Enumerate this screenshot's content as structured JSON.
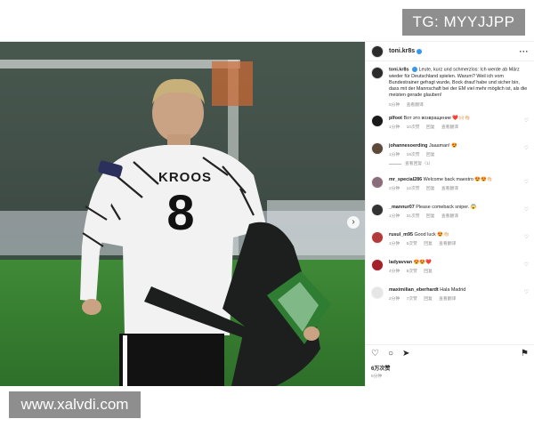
{
  "watermarks": {
    "top": "TG: MYYJJPP",
    "bottom": "www.xalvdi.com"
  },
  "photo": {
    "jersey_name": "KROOS",
    "jersey_number": "8"
  },
  "header": {
    "username": "toni.kr8s",
    "more": "···"
  },
  "caption": {
    "username": "toni.kr8s",
    "text": "Leute, kurz und schmerzlos: Ich werde ab März wieder für Deutschland spielen. Warum? Weil ich vom Bundestrainer gefragt wurde, Bock drauf habe und sicher bin, dass mit der Mannschaft bei der EM viel mehr möglich ist, als die meisten gerade glauben!",
    "time": "5分钟",
    "translate": "查看翻译"
  },
  "comments": [
    {
      "user": "plfoot",
      "text": "Вот это возвращение ❤️🙌🏻👏🏻",
      "time": "1分钟",
      "likes": "10次赞",
      "reply": "回复",
      "translate": "查看翻译",
      "color": "#1a1a1a"
    },
    {
      "user": "johannesoerding",
      "text": "Jaaaman! 😍",
      "time": "1分钟",
      "likes": "19次赞",
      "reply": "回复",
      "view_replies": "查看回复（1）",
      "color": "#5b4a3a"
    },
    {
      "user": "mr_special286",
      "text": "Welcome back maestro 😍😍👏🏻",
      "time": "2分钟",
      "likes": "12次赞",
      "reply": "回复",
      "translate": "查看翻译",
      "color": "#8a6d7a"
    },
    {
      "user": "_mannur07",
      "text": "Please comeback sniper. 😱",
      "time": "1分钟",
      "likes": "31次赞",
      "reply": "回复",
      "translate": "查看翻译",
      "color": "#333333"
    },
    {
      "user": "rusul_m95",
      "text": "Good luck 😍👏🏻",
      "time": "1分钟",
      "likes": "5次赞",
      "reply": "回复",
      "translate": "查看翻译",
      "color": "#b23a3a"
    },
    {
      "user": "ladyavvan",
      "text": "😍😍❤️",
      "time": "4分钟",
      "likes": "8次赞",
      "reply": "回复",
      "color": "#a31f2a"
    },
    {
      "user": "maximilian_eberhardt",
      "text": "Hala Madrid",
      "time": "2分钟",
      "likes": "7次赞",
      "reply": "回复",
      "translate": "查看翻译",
      "color": "#e6e6e6"
    }
  ],
  "actions": {
    "like": "♡",
    "comment": "○",
    "share": "➤",
    "save": "⚑"
  },
  "stats": {
    "likes": "6万次赞",
    "time": "5分钟"
  },
  "colors": {
    "verified": "#3897f0",
    "meta": "#8e8e8e",
    "jersey": "#f2f2f2"
  }
}
